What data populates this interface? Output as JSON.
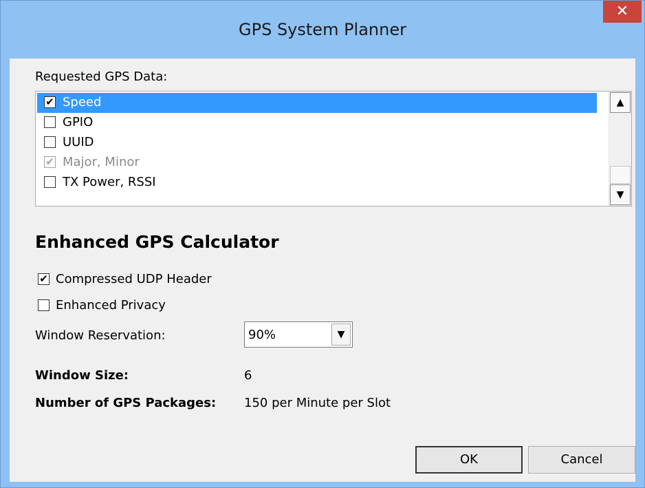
{
  "window": {
    "title": "GPS System Planner",
    "close_glyph": "✕"
  },
  "requested": {
    "label": "Requested GPS Data:",
    "items": [
      {
        "label": "Speed",
        "checked": true,
        "selected": true,
        "disabled": false
      },
      {
        "label": "GPIO",
        "checked": false,
        "selected": false,
        "disabled": false
      },
      {
        "label": "UUID",
        "checked": false,
        "selected": false,
        "disabled": false
      },
      {
        "label": "Major, Minor",
        "checked": true,
        "selected": false,
        "disabled": true
      },
      {
        "label": "TX Power, RSSI",
        "checked": false,
        "selected": false,
        "disabled": false
      }
    ],
    "check_glyph": "✔",
    "scroll_up_glyph": "▲",
    "scroll_down_glyph": "▼"
  },
  "calculator": {
    "heading": "Enhanced GPS Calculator",
    "compressed_udp": {
      "label": "Compressed UDP Header",
      "checked": true
    },
    "enhanced_privacy": {
      "label": "Enhanced Privacy",
      "checked": false
    },
    "window_reservation": {
      "label": "Window Reservation:",
      "value": "90%",
      "arrow_glyph": "▼"
    },
    "window_size": {
      "label": "Window Size:",
      "value": "6"
    },
    "gps_packages": {
      "label": "Number of GPS Packages:",
      "value": "150 per Minute per Slot"
    }
  },
  "buttons": {
    "ok": "OK",
    "cancel": "Cancel"
  },
  "colors": {
    "title_bar": "#8fc1f2",
    "close_button": "#c7453a",
    "selection": "#3399ff"
  }
}
